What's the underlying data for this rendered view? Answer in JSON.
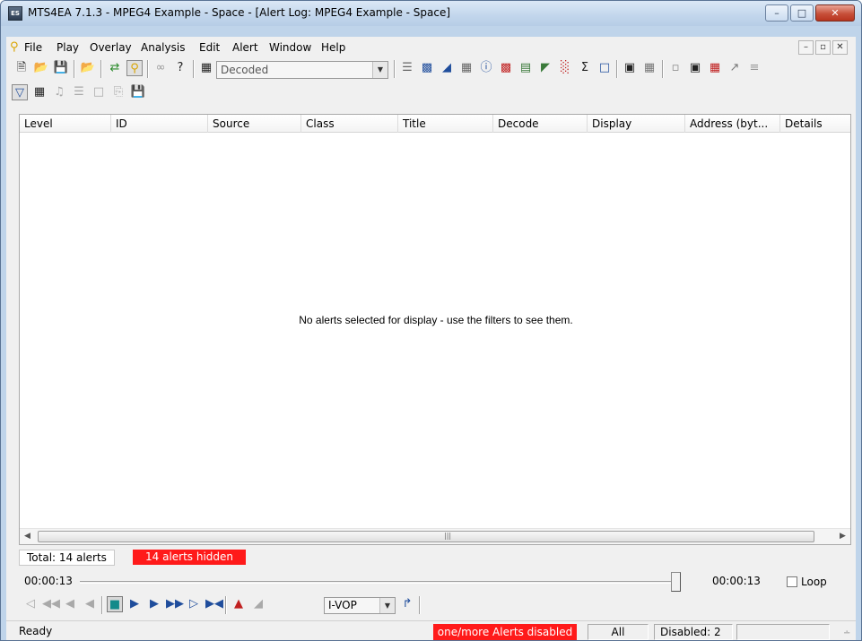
{
  "window": {
    "title": "MTS4EA 7.1.3 - MPEG4 Example - Space - [Alert Log: MPEG4 Example - Space]",
    "app_icon_text": "ES",
    "minimize": "–",
    "maximize": "□",
    "close": "✕"
  },
  "menu": {
    "items": [
      "File",
      "Play",
      "Overlay",
      "Analysis",
      "Edit",
      "Alert",
      "Window",
      "Help"
    ],
    "mdi_minimize": "–",
    "mdi_restore": "▫",
    "mdi_close": "✕"
  },
  "toolbar": {
    "display_combo": "Decoded"
  },
  "table": {
    "columns": [
      "Level",
      "ID",
      "Source",
      "Class",
      "Title",
      "Decode",
      "Display",
      "Address (byt...",
      "Details"
    ],
    "empty_message": "No alerts selected for display - use the filters to see them."
  },
  "counts": {
    "total": "Total: 14 alerts",
    "hidden": "14 alerts hidden"
  },
  "playback": {
    "time_start": "00:00:13",
    "time_end": "00:00:13",
    "loop_label": "Loop",
    "position_fraction": 1.0,
    "frame_type": "I-VOP"
  },
  "status": {
    "ready": "Ready",
    "alerts_disabled": "one/more Alerts disabled",
    "filter": "All",
    "disabled_count": "Disabled: 2"
  },
  "colors": {
    "alert_red": "#ff1a1a",
    "transport_blue": "#1f4d9c",
    "teal": "#138a8a"
  }
}
